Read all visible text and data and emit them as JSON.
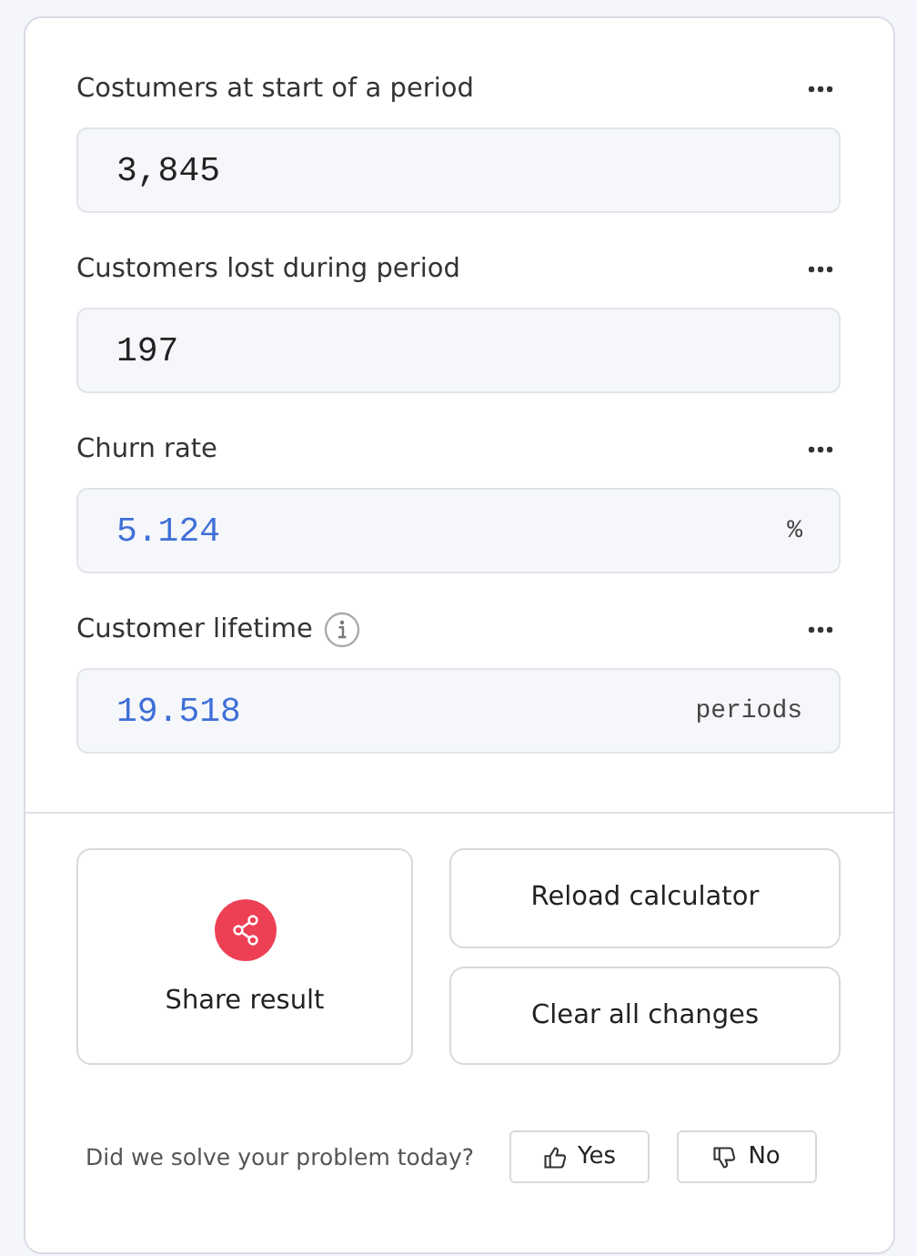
{
  "fields": [
    {
      "label": "Costumers at start of a period",
      "kind": "input",
      "value": "3,845",
      "info": false
    },
    {
      "label": "Customers lost during period",
      "kind": "input",
      "value": "197",
      "info": false
    },
    {
      "label": "Churn rate",
      "kind": "result",
      "value": "5.124",
      "unit": "%",
      "info": false
    },
    {
      "label": "Customer lifetime",
      "kind": "result",
      "value": "19.518",
      "unit": "periods",
      "info": true
    }
  ],
  "share_button": "Share result",
  "buttons": [
    "Reload calculator",
    "Clear all changes"
  ],
  "feedback": {
    "question": "Did we solve your problem today?",
    "yes": "Yes",
    "no": "No"
  }
}
